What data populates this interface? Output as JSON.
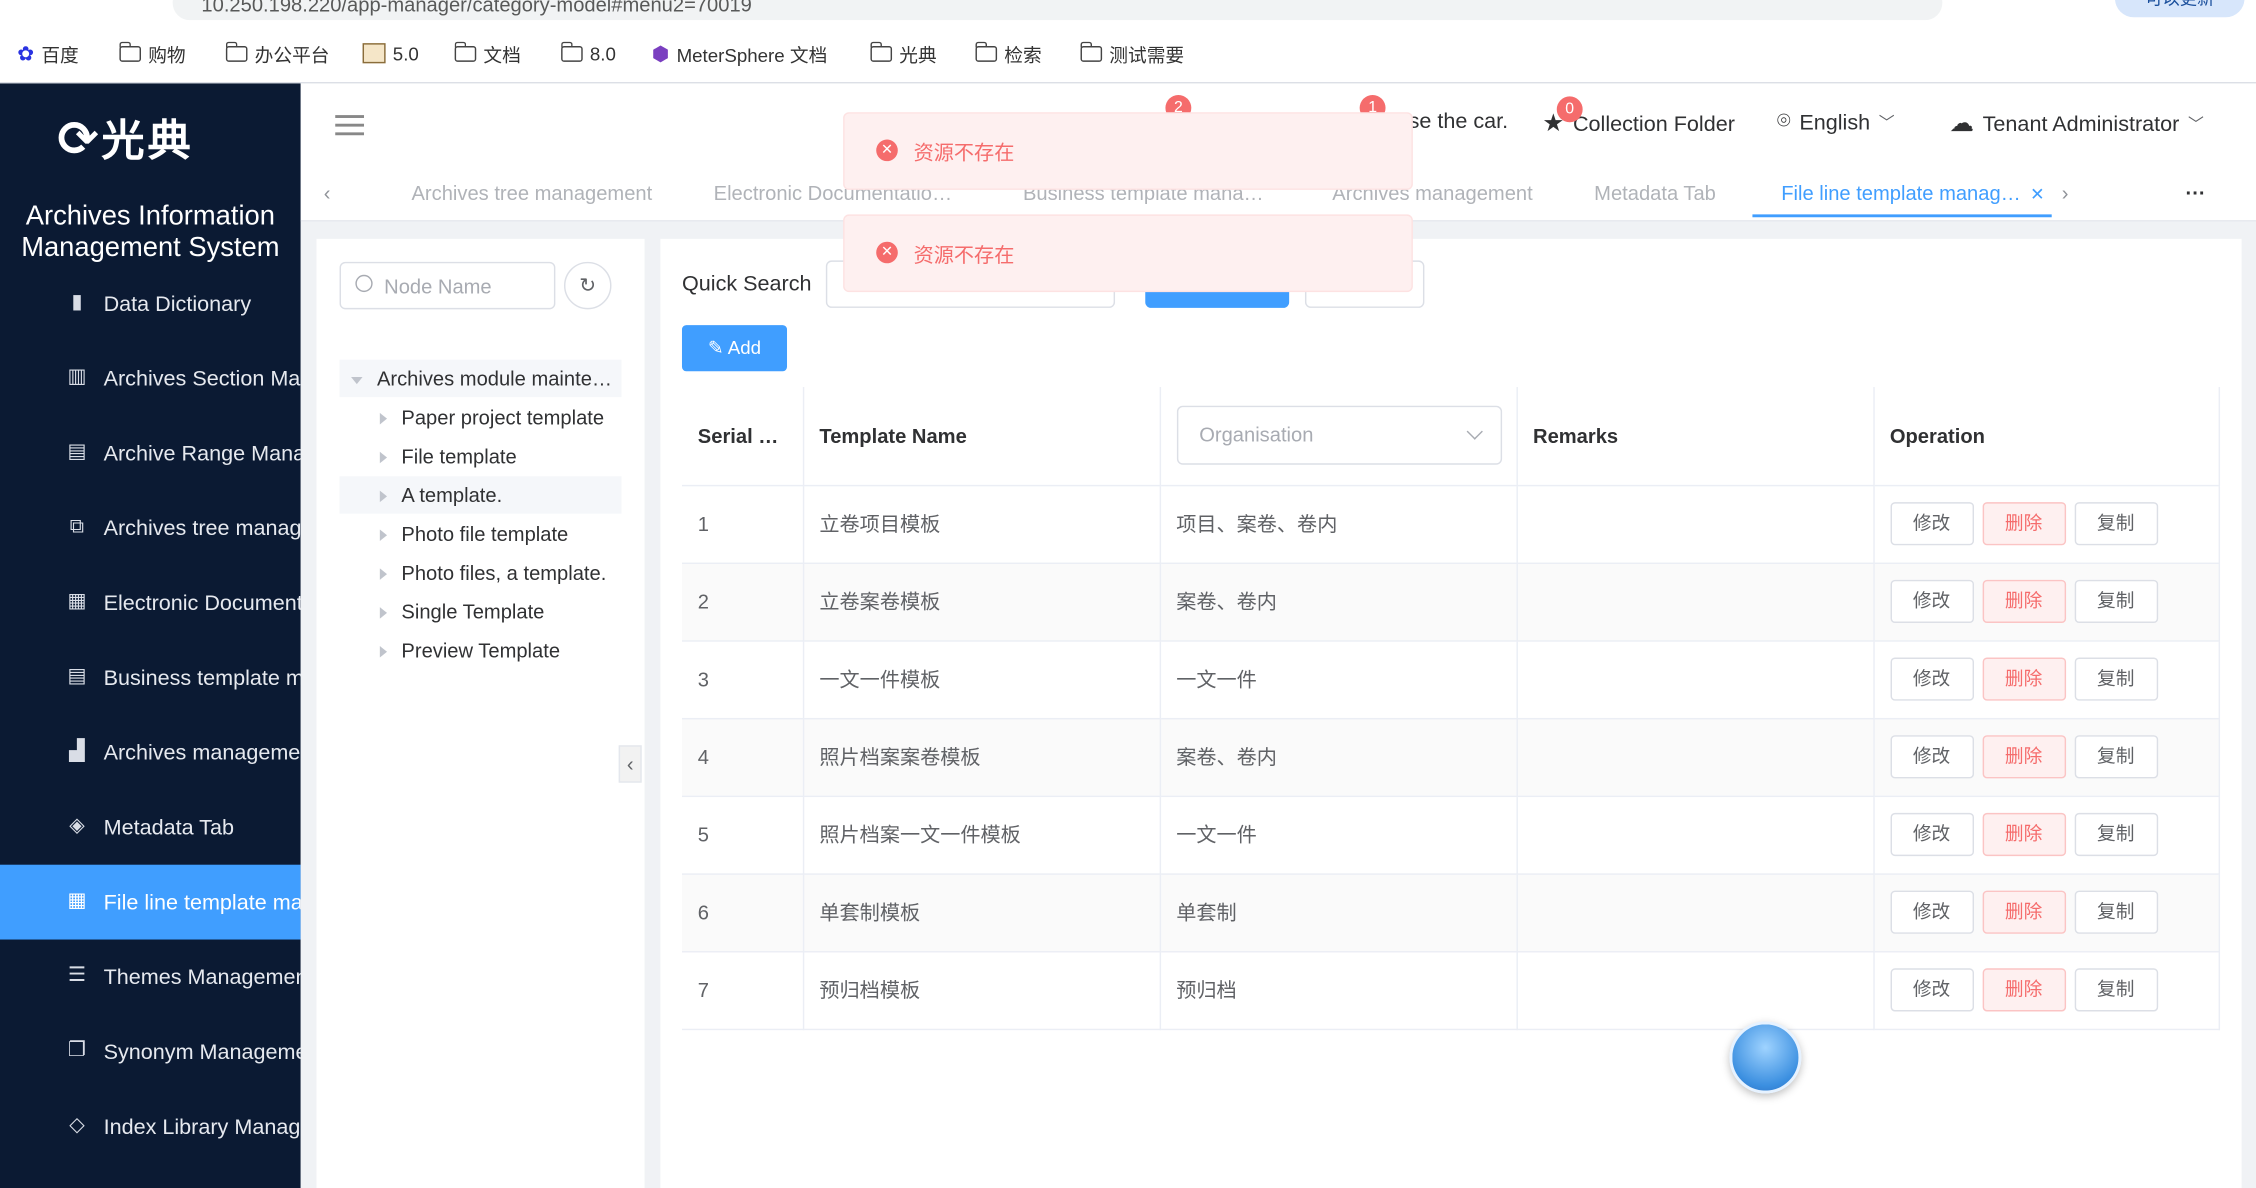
{
  "browser": {
    "url": "10.250.198.220/app-manager/category-model#menu2=70019",
    "update_label": "可以更新",
    "bookmarks": [
      "百度",
      "购物",
      "办公平台",
      "5.0",
      "文档",
      "8.0",
      "MeterSphere 文档",
      "光典",
      "检索",
      "测试需要"
    ]
  },
  "sidebar": {
    "logo_text": "光典",
    "system_title": "Archives Information Management System",
    "items": [
      {
        "label": "Data Dictionary",
        "icon": "book-icon"
      },
      {
        "label": "Archives Section Mar",
        "icon": "books-icon"
      },
      {
        "label": "Archive Range Mana",
        "icon": "document-icon"
      },
      {
        "label": "Archives tree manage",
        "icon": "hierarchy-icon"
      },
      {
        "label": "Electronic Document",
        "icon": "building-icon"
      },
      {
        "label": "Business template ma",
        "icon": "list-box-icon"
      },
      {
        "label": "Archives managemer",
        "icon": "bar-chart-icon"
      },
      {
        "label": "Metadata Tab",
        "icon": "tag-icon"
      },
      {
        "label": "File line template mar",
        "icon": "table-icon"
      },
      {
        "label": "Themes Managemen",
        "icon": "list-icon"
      },
      {
        "label": "Synonym Manageme",
        "icon": "copy-icon"
      },
      {
        "label": "Index Library Manag",
        "icon": "layers-icon"
      }
    ]
  },
  "header": {
    "notif_badge_1": "2",
    "notif_badge_2": "1",
    "use_car": "se the car.",
    "collection_badge": "0",
    "collection": "Collection Folder",
    "language": "English",
    "user": "Tenant Administrator"
  },
  "tabs": [
    {
      "label": "Archives tree management"
    },
    {
      "label": "Electronic Documentatio…"
    },
    {
      "label": "Business template mana…"
    },
    {
      "label": "Archives management"
    },
    {
      "label": "Metadata Tab"
    },
    {
      "label": "File line template manag…"
    }
  ],
  "tree": {
    "search_placeholder": "Node Name",
    "root": "Archives module mainte…",
    "children": [
      "Paper project template",
      "File template",
      "A template.",
      "Photo file template",
      "Photo files, a template.",
      "Single Template",
      "Preview Template"
    ]
  },
  "search": {
    "label": "Quick Search",
    "add_label": "Add"
  },
  "table": {
    "headers": {
      "serial": "Serial …",
      "name": "Template Name",
      "org": "Organisation",
      "remarks": "Remarks",
      "operation": "Operation"
    },
    "rows": [
      {
        "serial": "1",
        "name": "立卷项目模板",
        "org": "项目、案卷、卷内",
        "remarks": ""
      },
      {
        "serial": "2",
        "name": "立卷案卷模板",
        "org": "案卷、卷内",
        "remarks": ""
      },
      {
        "serial": "3",
        "name": "一文一件模板",
        "org": "一文一件",
        "remarks": ""
      },
      {
        "serial": "4",
        "name": "照片档案案卷模板",
        "org": "案卷、卷内",
        "remarks": ""
      },
      {
        "serial": "5",
        "name": "照片档案一文一件模板",
        "org": "一文一件",
        "remarks": ""
      },
      {
        "serial": "6",
        "name": "单套制模板",
        "org": "单套制",
        "remarks": ""
      },
      {
        "serial": "7",
        "name": "预归档模板",
        "org": "预归档",
        "remarks": ""
      }
    ],
    "ops": {
      "edit": "修改",
      "delete": "删除",
      "copy": "复制"
    }
  },
  "toasts": [
    "资源不存在",
    "资源不存在"
  ],
  "colors": {
    "primary": "#409eff",
    "sidebar": "#0b1a33",
    "danger": "#f56c6c"
  }
}
